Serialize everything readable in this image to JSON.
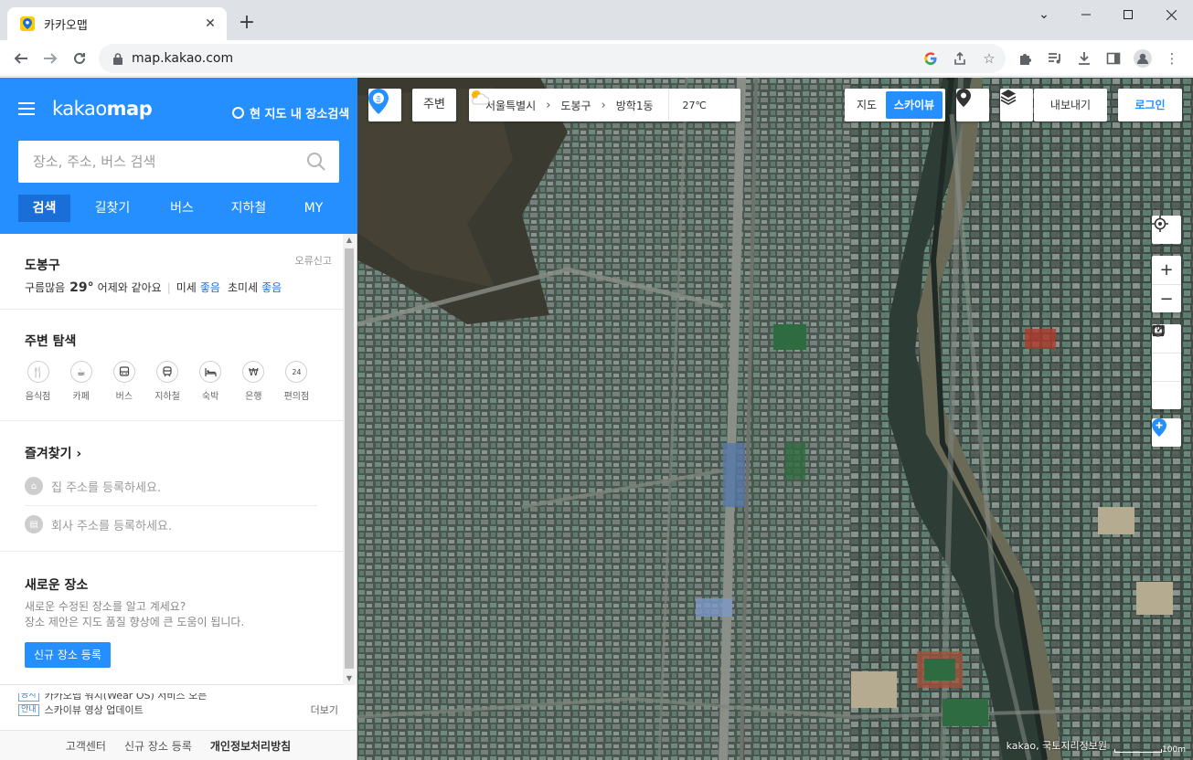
{
  "browser": {
    "tab_title": "카카오맵",
    "url": "map.kakao.com"
  },
  "sidebar": {
    "logo_light": "kakao",
    "logo_bold": "map",
    "area_search": "현 지도 내 장소검색",
    "search_placeholder": "장소, 주소, 버스 검색",
    "tabs": [
      "검색",
      "길찾기",
      "버스",
      "지하철",
      "MY"
    ],
    "weather": {
      "region": "도봉구",
      "report": "오류신고",
      "condition": "구름많음",
      "temp": "29°",
      "compare": "어제와 같아요",
      "dust_label": "미세",
      "dust_value": "좋음",
      "fine_dust_label": "초미세",
      "fine_dust_value": "좋음"
    },
    "nearby": {
      "title": "주변 탐색",
      "items": [
        {
          "icon": "restaurant-icon",
          "label": "음식점"
        },
        {
          "icon": "cafe-icon",
          "label": "카페"
        },
        {
          "icon": "bus-icon",
          "label": "버스"
        },
        {
          "icon": "subway-icon",
          "label": "지하철"
        },
        {
          "icon": "lodging-icon",
          "label": "숙박"
        },
        {
          "icon": "bank-icon",
          "label": "은행"
        },
        {
          "icon": "convenience-store-icon",
          "label": "편의점"
        }
      ]
    },
    "favorites": {
      "title": "즐겨찾기",
      "home": "집 주소를 등록하세요.",
      "work": "회사 주소를 등록하세요."
    },
    "new_place": {
      "title": "새로운 장소",
      "desc1": "새로운 수정된 장소를 알고 계세요?",
      "desc2": "장소 제안은 지도 품질 향상에 큰 도움이 됩니다.",
      "button": "신규 장소 등록"
    },
    "notices": [
      {
        "badge": "공지",
        "text": "카카오맵 워치(Wear OS) 서비스 오픈"
      },
      {
        "badge": "안내",
        "text": "스카이뷰 영상 업데이트"
      }
    ],
    "notice_more": "더보기",
    "footer": {
      "support": "고객센터",
      "register": "신규 장소 등록",
      "privacy": "개인정보처리방침"
    }
  },
  "map": {
    "nearby_button": "주변",
    "breadcrumb": [
      "서울특별시",
      "도봉구",
      "방학1동"
    ],
    "weather_temp": "27℃",
    "maptype": {
      "map": "지도",
      "skyview": "스카이뷰",
      "active": "skyview"
    },
    "export": "내보내기",
    "login": "로그인",
    "zoom_in": "+",
    "zoom_out": "−",
    "copyright": "kakao, 국토지리정보원",
    "scale_label": "100m"
  },
  "colors": {
    "brand_blue": "#258fff",
    "tab_active": "#1a6ed8",
    "favicon_yellow": "#ffcd00"
  }
}
